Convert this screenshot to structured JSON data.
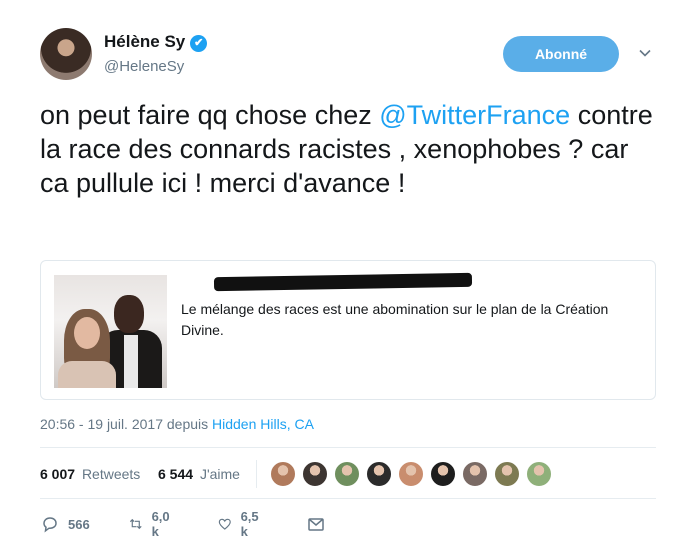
{
  "user": {
    "name": "Hélène Sy",
    "verified_icon": "✔",
    "handle": "@HeleneSy",
    "follow_label": "Abonné"
  },
  "tweet": {
    "text_before": "on peut faire qq chose chez ",
    "mention": "@TwitterFrance",
    "text_after": " contre la race des connards racistes , xenophobes  ? car ca pullule ici ! merci d'avance !"
  },
  "quote": {
    "author_redacted": true,
    "text": "Le mélange des races est une abomination sur le plan de la Création Divine."
  },
  "meta": {
    "time_date": "20:56 - 19 juil. 2017 depuis ",
    "place": "Hidden Hills, CA"
  },
  "stats": {
    "retweets_count": "6 007",
    "retweets_label": "Retweets",
    "likes_count": "6 544",
    "likes_label": "J'aime"
  },
  "likers": [
    {
      "color": "#b07a5c"
    },
    {
      "color": "#3d3531"
    },
    {
      "color": "#6f8f5e"
    },
    {
      "color": "#2b2b2b"
    },
    {
      "color": "#c98d6e"
    },
    {
      "color": "#1e1e1e"
    },
    {
      "color": "#7a6a64"
    },
    {
      "color": "#7d7a52"
    },
    {
      "color": "#8fb07a"
    }
  ],
  "actions": {
    "reply_count": "566",
    "retweet_count": "6,0 k",
    "like_count": "6,5 k"
  },
  "colors": {
    "accent": "#1da1f2",
    "button": "#5aaee8",
    "muted": "#657786"
  }
}
